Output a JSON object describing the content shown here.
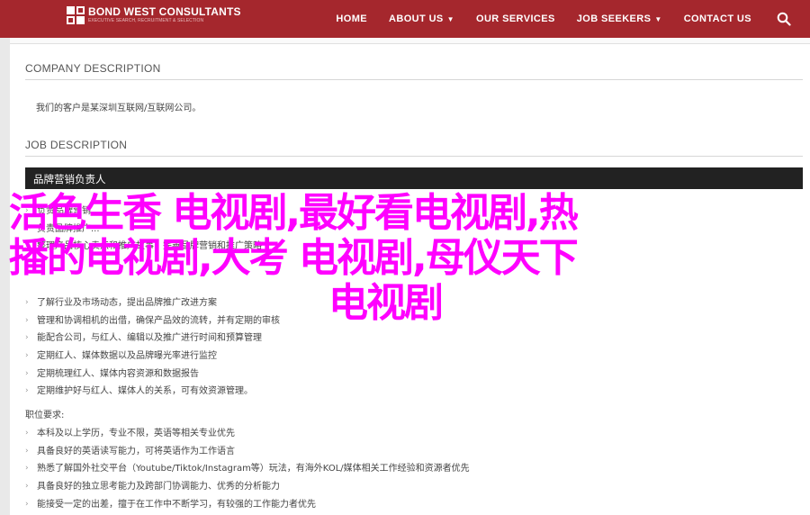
{
  "header": {
    "logo_name": "BOND WEST CONSULTANTS",
    "logo_tagline": "EXECUTIVE SEARCH, RECRUITMENT & SELECTION",
    "nav": [
      {
        "label": "HOME",
        "has_caret": false
      },
      {
        "label": "ABOUT US",
        "has_caret": true
      },
      {
        "label": "OUR SERVICES",
        "has_caret": false
      },
      {
        "label": "JOB SEEKERS",
        "has_caret": true
      },
      {
        "label": "CONTACT US",
        "has_caret": false
      }
    ],
    "caret_glyph": "▼",
    "brand_color": "#a5272d"
  },
  "company": {
    "heading": "COMPANY DESCRIPTION",
    "text": "我们的客户是某深圳互联网/互联网公司。"
  },
  "job": {
    "heading": "JOB DESCRIPTION",
    "title_bar": "品牌营销负责人",
    "duties_partial": [
      "负责品牌营销...",
      "负责品牌推广...",
      "整理产品核心卖点和推广故事，完善品牌营销和推广策略"
    ],
    "duties": [
      "了解行业及市场动态，提出品牌推广改进方案",
      "管理和协调相机的出借，确保产品效的流转，并有定期的审核",
      "能配合公司，与红人、编辑以及推广进行时间和预算管理",
      "定期红人、媒体数据以及品牌曝光率进行监控",
      "定期梳理红人、媒体内容资源和数据报告",
      "定期维护好与红人、媒体人的关系，可有效资源管理。"
    ],
    "req_heading": "职位要求:",
    "requirements": [
      "本科及以上学历，专业不限，英语等相关专业优先",
      "具备良好的英语读写能力，可将英语作为工作语言",
      "熟悉了解国外社交平台（Youtube/Tiktok/Instagram等）玩法，有海外KOL/媒体相关工作经验和资源者优先",
      "具备良好的独立思考能力及跨部门协调能力、优秀的分析能力",
      "能接受一定的出差，擅于在工作中不断学习，有较强的工作能力者优先"
    ]
  },
  "overlay": {
    "line1": "活色生香 电视剧,最好看电视剧,热",
    "line2": "播的电视剧,大考 电视剧,母仪天下",
    "line3": "电视剧",
    "color": "#ff00ff"
  }
}
